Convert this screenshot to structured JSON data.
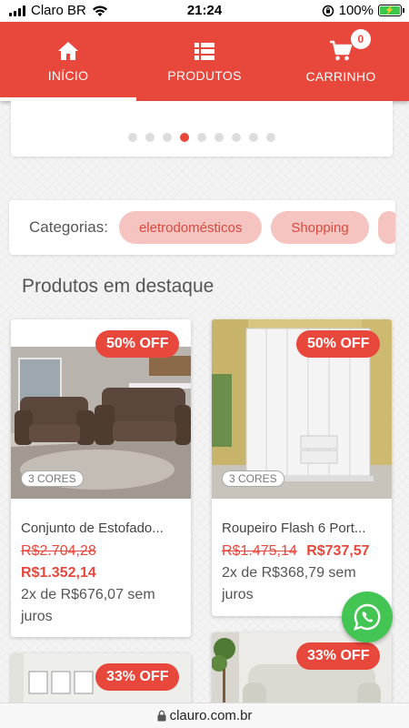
{
  "status_bar": {
    "carrier": "Claro BR",
    "time": "21:24",
    "battery": "100%"
  },
  "nav": {
    "items": [
      {
        "label": "INÍCIO",
        "icon": "home-icon",
        "active": true
      },
      {
        "label": "PRODUTOS",
        "icon": "list-icon",
        "active": false
      },
      {
        "label": "CARRINHO",
        "icon": "cart-icon",
        "active": false
      }
    ],
    "cart_count": "0"
  },
  "carousel": {
    "dot_count": 9,
    "active_index": 3
  },
  "categories": {
    "label": "Categorias:",
    "chips": [
      "eletrodomésticos",
      "Shopping"
    ]
  },
  "featured": {
    "title": "Produtos em destaque"
  },
  "products": [
    {
      "discount": "50% OFF",
      "colors": "3 CORES",
      "name": "Conjunto de Estofado...",
      "old_price": "R$2.704,28",
      "new_price": "R$1.352,14",
      "installments": "2x de R$676,07 sem juros"
    },
    {
      "discount": "50% OFF",
      "colors": "3 CORES",
      "name": "Roupeiro Flash 6 Port...",
      "old_price": "R$1.475,14",
      "new_price": "R$737,57",
      "installments": "2x de R$368,79 sem juros"
    },
    {
      "discount": "33% OFF"
    },
    {
      "discount": "33% OFF"
    }
  ],
  "url": "clauro.com.br",
  "colors": {
    "brand": "#e8473c",
    "chip_bg": "#f6c4c0",
    "whatsapp": "#43c553"
  }
}
